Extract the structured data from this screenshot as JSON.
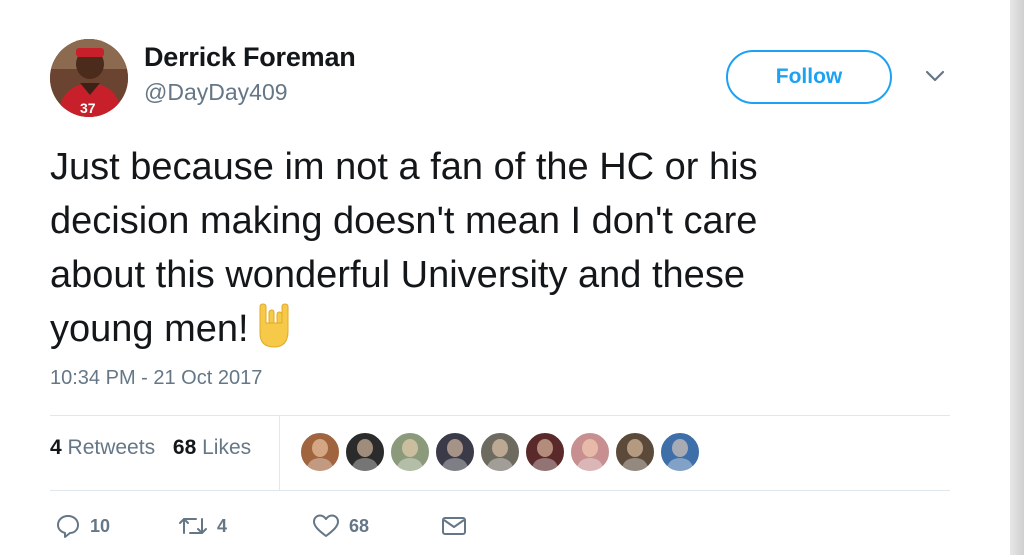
{
  "author": {
    "name": "Derrick Foreman",
    "handle": "@DayDay409"
  },
  "follow_button": {
    "label": "Follow"
  },
  "tweet": {
    "lines": [
      "Just because im not a fan of the HC or his",
      "decision making doesn't mean I don't care",
      "about this wonderful University and these",
      "young men!"
    ],
    "emoji": "sign-of-the-horns-icon",
    "timestamp": "10:34 PM - 21 Oct 2017"
  },
  "stats": {
    "retweets_count": "4",
    "retweets_label": "Retweets",
    "likes_count": "68",
    "likes_label": "Likes"
  },
  "liker_faces": [
    {
      "bg": "#a0643e"
    },
    {
      "bg": "#2b2b2b"
    },
    {
      "bg": "#8a9a7a"
    },
    {
      "bg": "#3a3a48"
    },
    {
      "bg": "#6d6a60"
    },
    {
      "bg": "#5a2a2a"
    },
    {
      "bg": "#c78f8f"
    },
    {
      "bg": "#5b4a3a"
    },
    {
      "bg": "#3e6fa8"
    }
  ],
  "actions": {
    "reply_count": "10",
    "retweet_count": "4",
    "like_count": "68"
  },
  "colors": {
    "accent": "#1da1f2",
    "secondary_text": "#657786",
    "primary_text": "#14171a"
  }
}
